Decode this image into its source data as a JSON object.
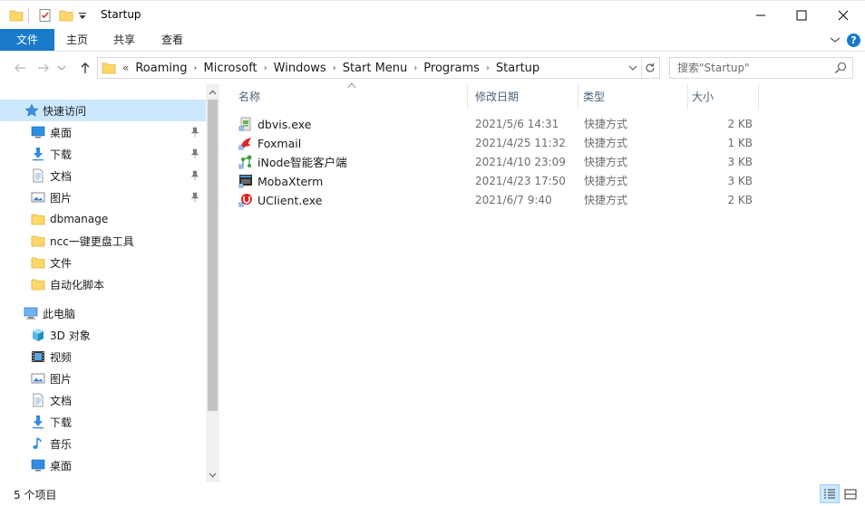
{
  "window": {
    "title": "Startup",
    "minimize_glyph": "—",
    "maximize_glyph": "☐",
    "close_glyph": "✕"
  },
  "ribbon": {
    "tabs": [
      "文件",
      "主页",
      "共享",
      "查看"
    ],
    "help": "?"
  },
  "address": {
    "overflow": "«",
    "crumbs": [
      "Roaming",
      "Microsoft",
      "Windows",
      "Start Menu",
      "Programs",
      "Startup"
    ]
  },
  "search": {
    "placeholder": "搜索\"Startup\""
  },
  "nav": {
    "quick_access": "快速访问",
    "items": [
      {
        "label": "桌面",
        "icon": "desktop-icon",
        "pinned": true
      },
      {
        "label": "下载",
        "icon": "download-icon",
        "pinned": true
      },
      {
        "label": "文档",
        "icon": "documents-icon",
        "pinned": true
      },
      {
        "label": "图片",
        "icon": "pictures-icon",
        "pinned": true
      },
      {
        "label": "dbmanage",
        "icon": "folder-icon",
        "pinned": false
      },
      {
        "label": "ncc一键更盘工具",
        "icon": "folder-icon",
        "pinned": false
      },
      {
        "label": "文件",
        "icon": "folder-icon",
        "pinned": false
      },
      {
        "label": "自动化脚本",
        "icon": "folder-icon",
        "pinned": false
      }
    ],
    "this_pc": "此电脑",
    "pc_items": [
      {
        "label": "3D 对象",
        "icon": "3d-objects-icon"
      },
      {
        "label": "视频",
        "icon": "videos-icon"
      },
      {
        "label": "图片",
        "icon": "pictures-icon"
      },
      {
        "label": "文档",
        "icon": "documents-icon"
      },
      {
        "label": "下载",
        "icon": "download-icon"
      },
      {
        "label": "音乐",
        "icon": "music-icon"
      },
      {
        "label": "桌面",
        "icon": "desktop-icon"
      }
    ]
  },
  "columns": {
    "name": "名称",
    "date": "修改日期",
    "type": "类型",
    "size": "大小"
  },
  "files": [
    {
      "name": "dbvis.exe",
      "date": "2021/5/6 14:31",
      "type": "快捷方式",
      "size": "2 KB",
      "icon": "dbvis-icon"
    },
    {
      "name": "Foxmail",
      "date": "2021/4/25 11:32",
      "type": "快捷方式",
      "size": "1 KB",
      "icon": "foxmail-icon"
    },
    {
      "name": "iNode智能客户端",
      "date": "2021/4/10 23:09",
      "type": "快捷方式",
      "size": "3 KB",
      "icon": "inode-icon"
    },
    {
      "name": "MobaXterm",
      "date": "2021/4/23 17:50",
      "type": "快捷方式",
      "size": "3 KB",
      "icon": "mobaxterm-icon"
    },
    {
      "name": "UClient.exe",
      "date": "2021/6/7 9:40",
      "type": "快捷方式",
      "size": "2 KB",
      "icon": "uclient-icon"
    }
  ],
  "status": {
    "count": "5 个项目"
  },
  "colors": {
    "accent": "#1979ca",
    "selection": "#cce8ff",
    "folder": "#ffd869"
  }
}
